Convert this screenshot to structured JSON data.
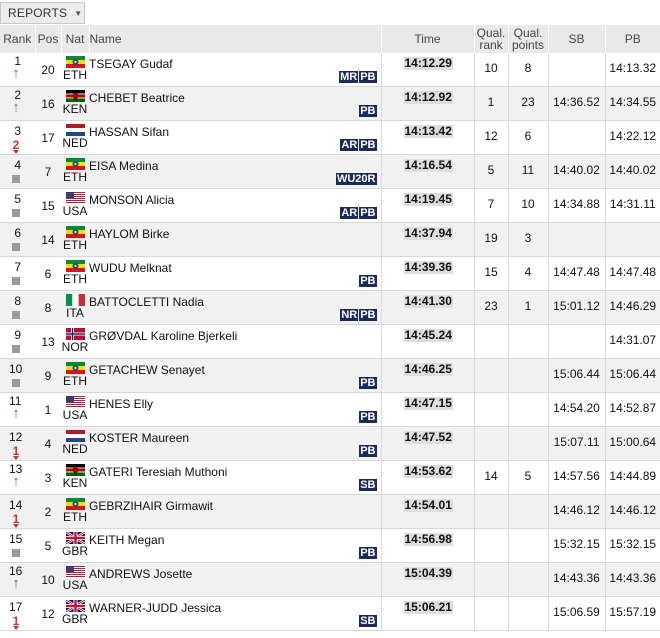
{
  "toolbar": {
    "reports_label": "REPORTS",
    "caret": "▼"
  },
  "columns": {
    "rank": "Rank",
    "pos": "Pos",
    "nat": "Nat",
    "name": "Name",
    "time": "Time",
    "qual_rank": "Qual. rank",
    "qual_points": "Qual. points",
    "sb": "SB",
    "pb": "PB"
  },
  "rows": [
    {
      "rank": "1",
      "move": "up",
      "move_num": "",
      "pos": "20",
      "nat": "ETH",
      "name": "TSEGAY Gudaf",
      "badges": [
        "MR",
        "PB"
      ],
      "time": "14:12.29",
      "qual_rank": "10",
      "qual_points": "8",
      "sb": "",
      "pb": "14:13.32"
    },
    {
      "rank": "2",
      "move": "up",
      "move_num": "",
      "pos": "16",
      "nat": "KEN",
      "name": "CHEBET Beatrice",
      "badges": [
        "PB"
      ],
      "time": "14:12.92",
      "qual_rank": "1",
      "qual_points": "23",
      "sb": "14:36.52",
      "pb": "14:34.55"
    },
    {
      "rank": "3",
      "move": "down",
      "move_num": "2",
      "pos": "17",
      "nat": "NED",
      "name": "HASSAN Sifan",
      "badges": [
        "AR",
        "PB"
      ],
      "time": "14:13.42",
      "qual_rank": "12",
      "qual_points": "6",
      "sb": "",
      "pb": "14:22.12"
    },
    {
      "rank": "4",
      "move": "same",
      "move_num": "",
      "pos": "7",
      "nat": "ETH",
      "name": "EISA Medina",
      "badges": [
        "WU20R"
      ],
      "time": "14:16.54",
      "qual_rank": "5",
      "qual_points": "11",
      "sb": "14:40.02",
      "pb": "14:40.02"
    },
    {
      "rank": "5",
      "move": "same",
      "move_num": "",
      "pos": "15",
      "nat": "USA",
      "name": "MONSON Alicia",
      "badges": [
        "AR",
        "PB"
      ],
      "time": "14:19.45",
      "qual_rank": "7",
      "qual_points": "10",
      "sb": "14:34.88",
      "pb": "14:31.11"
    },
    {
      "rank": "6",
      "move": "same",
      "move_num": "",
      "pos": "14",
      "nat": "ETH",
      "name": "HAYLOM Birke",
      "badges": [],
      "time": "14:37.94",
      "qual_rank": "19",
      "qual_points": "3",
      "sb": "",
      "pb": ""
    },
    {
      "rank": "7",
      "move": "same",
      "move_num": "",
      "pos": "6",
      "nat": "ETH",
      "name": "WUDU Melknat",
      "badges": [
        "PB"
      ],
      "time": "14:39.36",
      "qual_rank": "15",
      "qual_points": "4",
      "sb": "14:47.48",
      "pb": "14:47.48"
    },
    {
      "rank": "8",
      "move": "same",
      "move_num": "",
      "pos": "8",
      "nat": "ITA",
      "name": "BATTOCLETTI Nadia",
      "badges": [
        "NR",
        "PB"
      ],
      "time": "14:41.30",
      "qual_rank": "23",
      "qual_points": "1",
      "sb": "15:01.12",
      "pb": "14:46.29"
    },
    {
      "rank": "9",
      "move": "same",
      "move_num": "",
      "pos": "13",
      "nat": "NOR",
      "name": "GRØVDAL Karoline Bjerkeli",
      "badges": [],
      "time": "14:45.24",
      "qual_rank": "",
      "qual_points": "",
      "sb": "",
      "pb": "14:31.07"
    },
    {
      "rank": "10",
      "move": "same",
      "move_num": "",
      "pos": "9",
      "nat": "ETH",
      "name": "GETACHEW Senayet",
      "badges": [
        "PB"
      ],
      "time": "14:46.25",
      "qual_rank": "",
      "qual_points": "",
      "sb": "15:06.44",
      "pb": "15:06.44"
    },
    {
      "rank": "11",
      "move": "up",
      "move_num": "",
      "pos": "1",
      "nat": "USA",
      "name": "HENES Elly",
      "badges": [
        "PB"
      ],
      "time": "14:47.15",
      "qual_rank": "",
      "qual_points": "",
      "sb": "14:54.20",
      "pb": "14:52.87"
    },
    {
      "rank": "12",
      "move": "down",
      "move_num": "1",
      "pos": "4",
      "nat": "NED",
      "name": "KOSTER Maureen",
      "badges": [
        "PB"
      ],
      "time": "14:47.52",
      "qual_rank": "",
      "qual_points": "",
      "sb": "15:07.11",
      "pb": "15:00.64"
    },
    {
      "rank": "13",
      "move": "up",
      "move_num": "",
      "pos": "3",
      "nat": "KEN",
      "name": "GATERI Teresiah Muthoni",
      "badges": [
        "SB"
      ],
      "time": "14:53.62",
      "qual_rank": "14",
      "qual_points": "5",
      "sb": "14:57.56",
      "pb": "14:44.89"
    },
    {
      "rank": "14",
      "move": "down",
      "move_num": "1",
      "pos": "2",
      "nat": "ETH",
      "name": "GEBRZIHAIR Girmawit",
      "badges": [],
      "time": "14:54.01",
      "qual_rank": "",
      "qual_points": "",
      "sb": "14:46.12",
      "pb": "14:46.12"
    },
    {
      "rank": "15",
      "move": "same",
      "move_num": "",
      "pos": "5",
      "nat": "GBR",
      "name": "KEITH Megan",
      "badges": [
        "PB"
      ],
      "time": "14:56.98",
      "qual_rank": "",
      "qual_points": "",
      "sb": "15:32.15",
      "pb": "15:32.15"
    },
    {
      "rank": "16",
      "move": "up",
      "move_num": "",
      "pos": "10",
      "nat": "USA",
      "name": "ANDREWS Josette",
      "badges": [],
      "time": "15:04.39",
      "qual_rank": "",
      "qual_points": "",
      "sb": "14:43.36",
      "pb": "14:43.36"
    },
    {
      "rank": "17",
      "move": "down",
      "move_num": "1",
      "pos": "12",
      "nat": "GBR",
      "name": "WARNER-JUDD Jessica",
      "badges": [
        "SB"
      ],
      "time": "15:06.21",
      "qual_rank": "",
      "qual_points": "",
      "sb": "15:06.59",
      "pb": "15:57.19"
    }
  ]
}
